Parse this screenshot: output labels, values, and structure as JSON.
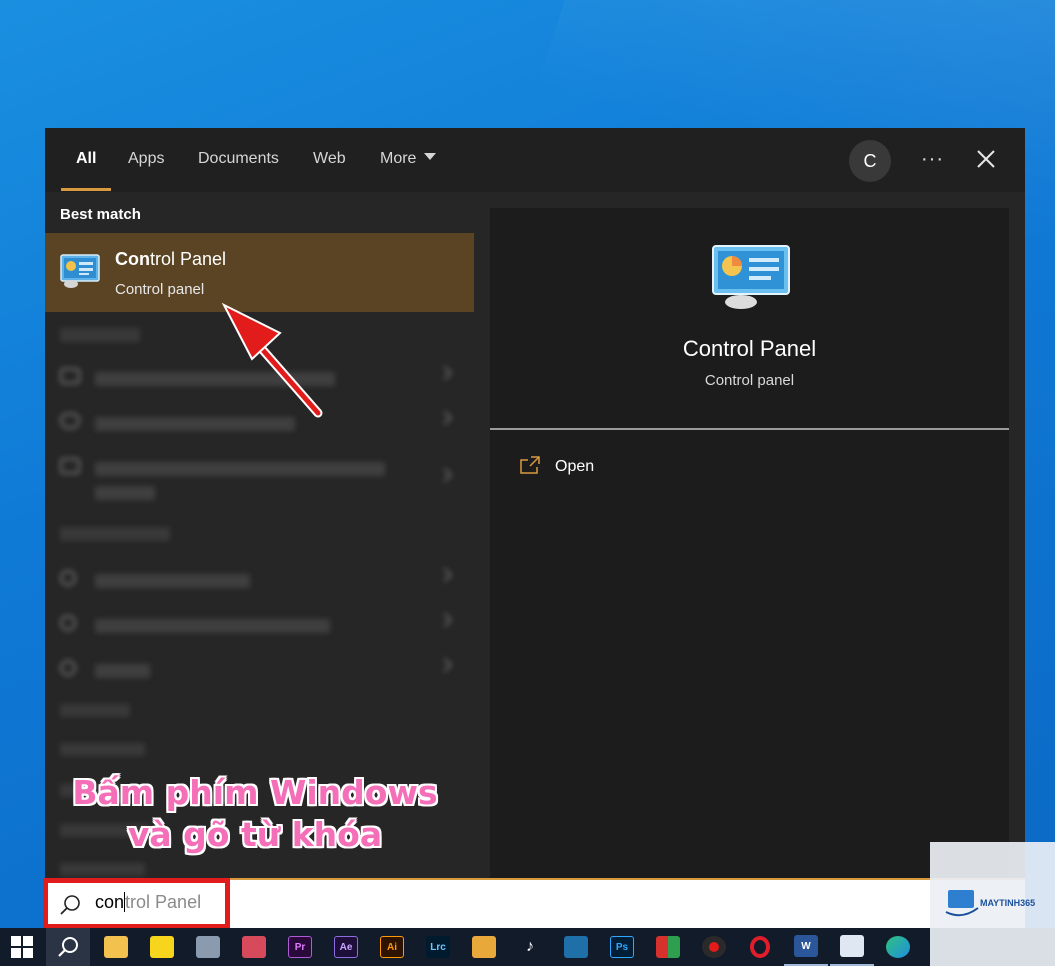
{
  "tabs": {
    "all": "All",
    "apps": "Apps",
    "documents": "Documents",
    "web": "Web",
    "more": "More"
  },
  "account_initial": "C",
  "best_match": {
    "heading": "Best match",
    "title_bold": "Con",
    "title_rest": "trol Panel",
    "subtitle": "Control panel"
  },
  "preview": {
    "title": "Control Panel",
    "subtitle": "Control panel",
    "open_label": "Open"
  },
  "search": {
    "typed": "con",
    "suggestion": "trol Panel"
  },
  "annotation": {
    "line1": "Bấm phím Windows",
    "line2": "và gõ từ khóa"
  },
  "watermark": {
    "brand": "MAYTINH365"
  },
  "colors": {
    "accent": "#d99a3f",
    "selected_bg": "#5a4424",
    "highlight_border": "#e21b1b",
    "annotation_text": "#f46fb7"
  }
}
